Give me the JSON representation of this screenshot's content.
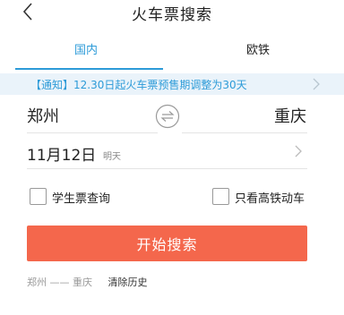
{
  "header": {
    "title": "火车票搜索"
  },
  "tabs": [
    {
      "label": "国内",
      "active": true
    },
    {
      "label": "欧铁",
      "active": false
    }
  ],
  "notice": {
    "text": "【通知】12.30日起火车票预售期调整为30天"
  },
  "route": {
    "from": "郑州",
    "to": "重庆"
  },
  "date": {
    "value": "11月12日",
    "note": "明天"
  },
  "options": {
    "student_label": "学生票查询",
    "hsr_label": "只看高铁动车"
  },
  "search_button": {
    "label": "开始搜索"
  },
  "history": {
    "item": "郑州 —— 重庆",
    "clear_label": "清除历史"
  },
  "colors": {
    "accent": "#2d9bd8",
    "button": "#f4674c",
    "notice_bg": "#eaf3fa"
  },
  "icons": {
    "back": "chevron-left-icon",
    "swap": "swap-icon",
    "arrow": "chevron-right-icon"
  }
}
